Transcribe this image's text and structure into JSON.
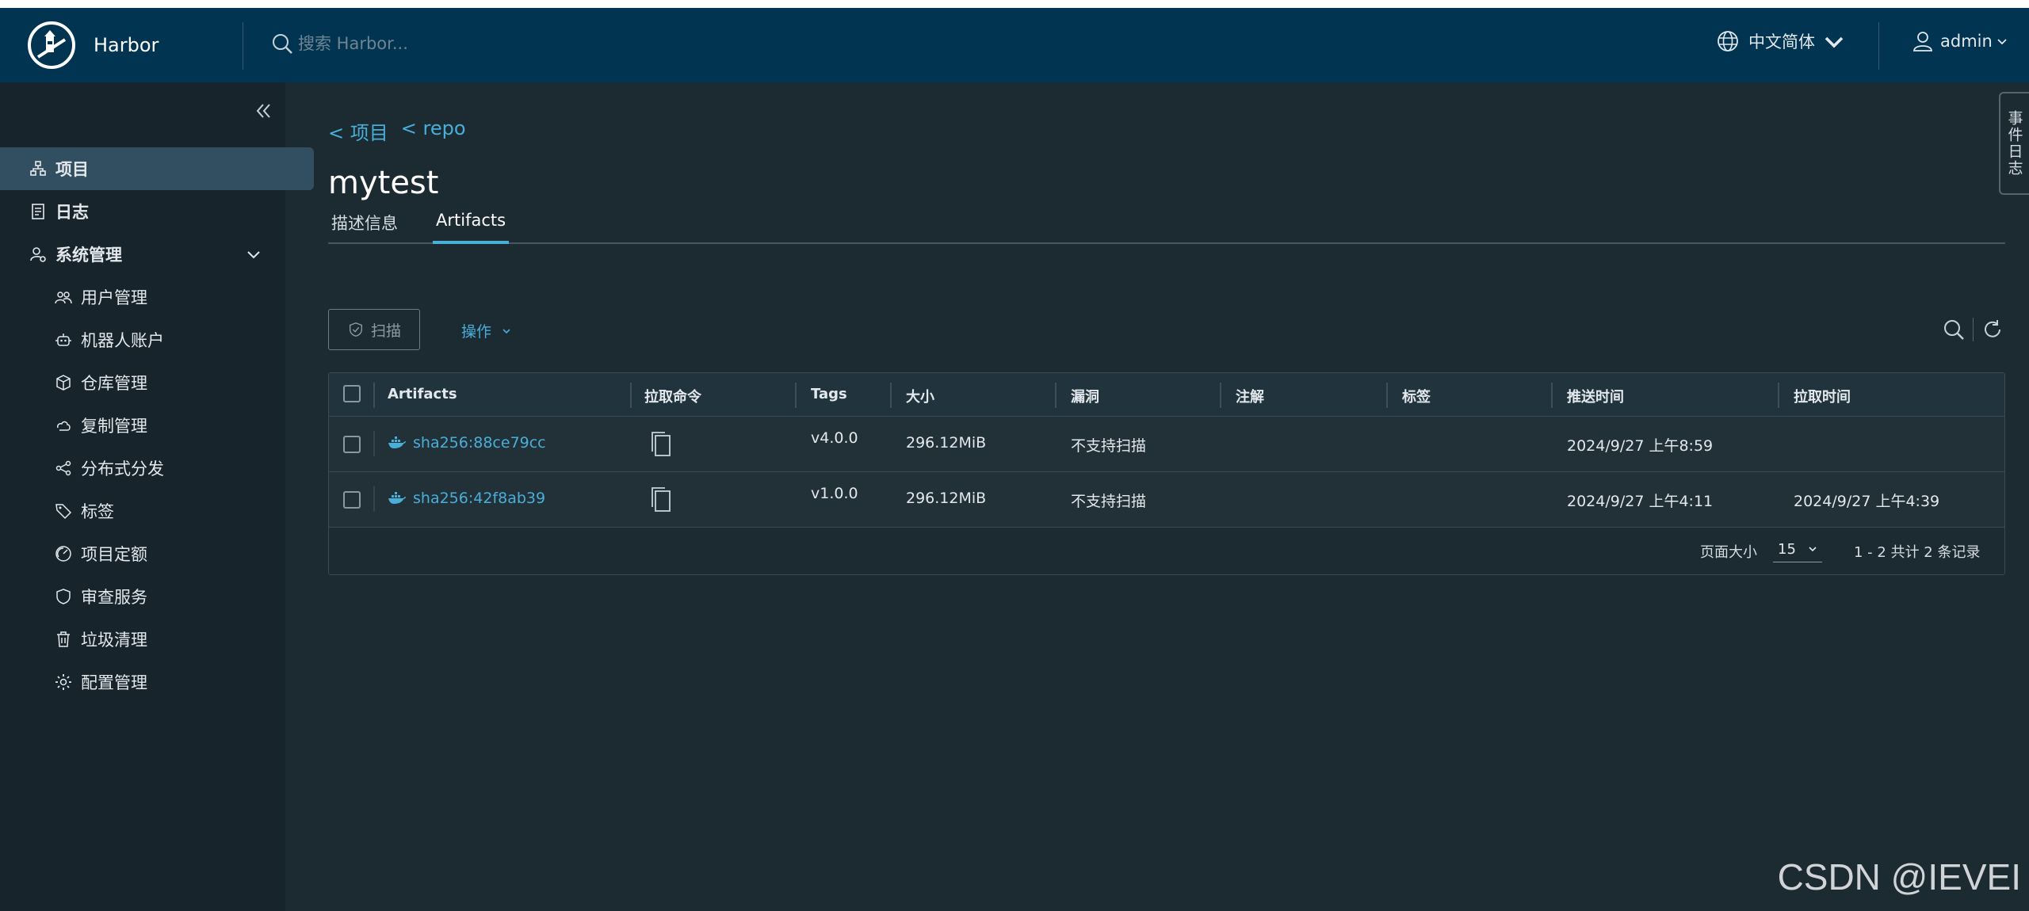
{
  "header": {
    "brand": "Harbor",
    "search_placeholder": "搜索 Harbor...",
    "language": "中文简体",
    "user": "admin"
  },
  "sidebar": {
    "items": [
      {
        "label": "项目",
        "icon": "project-icon",
        "active": true
      },
      {
        "label": "日志",
        "icon": "log-icon"
      },
      {
        "label": "系统管理",
        "icon": "system-admin-icon",
        "expanded": true
      },
      {
        "label": "用户管理",
        "icon": "users-icon"
      },
      {
        "label": "机器人账户",
        "icon": "robot-icon"
      },
      {
        "label": "仓库管理",
        "icon": "registry-icon"
      },
      {
        "label": "复制管理",
        "icon": "replication-icon"
      },
      {
        "label": "分布式分发",
        "icon": "share-icon"
      },
      {
        "label": "标签",
        "icon": "tag-icon"
      },
      {
        "label": "项目定额",
        "icon": "quota-icon"
      },
      {
        "label": "审查服务",
        "icon": "shield-icon"
      },
      {
        "label": "垃圾清理",
        "icon": "trash-icon"
      },
      {
        "label": "配置管理",
        "icon": "gear-icon"
      }
    ]
  },
  "main": {
    "breadcrumb": [
      "< 项目",
      "< repo"
    ],
    "title": "mytest",
    "tabs": [
      {
        "label": "描述信息",
        "active": false
      },
      {
        "label": "Artifacts",
        "active": true
      }
    ],
    "toolbar": {
      "scan_label": "扫描",
      "actions_label": "操作"
    },
    "table": {
      "columns": [
        "Artifacts",
        "拉取命令",
        "Tags",
        "大小",
        "漏洞",
        "注解",
        "标签",
        "推送时间",
        "拉取时间"
      ],
      "rows": [
        {
          "artifact": "sha256:88ce79cc",
          "tags": "v4.0.0",
          "size": "296.12MiB",
          "vulnerabilities": "不支持扫描",
          "annotations": "",
          "labels": "",
          "push_time": "2024/9/27 上午8:59",
          "pull_time": ""
        },
        {
          "artifact": "sha256:42f8ab39",
          "tags": "v1.0.0",
          "size": "296.12MiB",
          "vulnerabilities": "不支持扫描",
          "annotations": "",
          "labels": "",
          "push_time": "2024/9/27 上午4:11",
          "pull_time": "2024/9/27 上午4:39"
        }
      ]
    },
    "pagination": {
      "page_size_label": "页面大小",
      "page_size": "15",
      "summary": "1 - 2 共计 2 条记录"
    }
  },
  "event_log_tab": "事件日志",
  "watermark": "CSDN @IEVEI",
  "colors": {
    "header_bg": "#003450",
    "sidebar_bg": "#17242b",
    "content_bg": "#1c2a32",
    "accent": "#49afd9",
    "active_nav": "#324f62"
  }
}
